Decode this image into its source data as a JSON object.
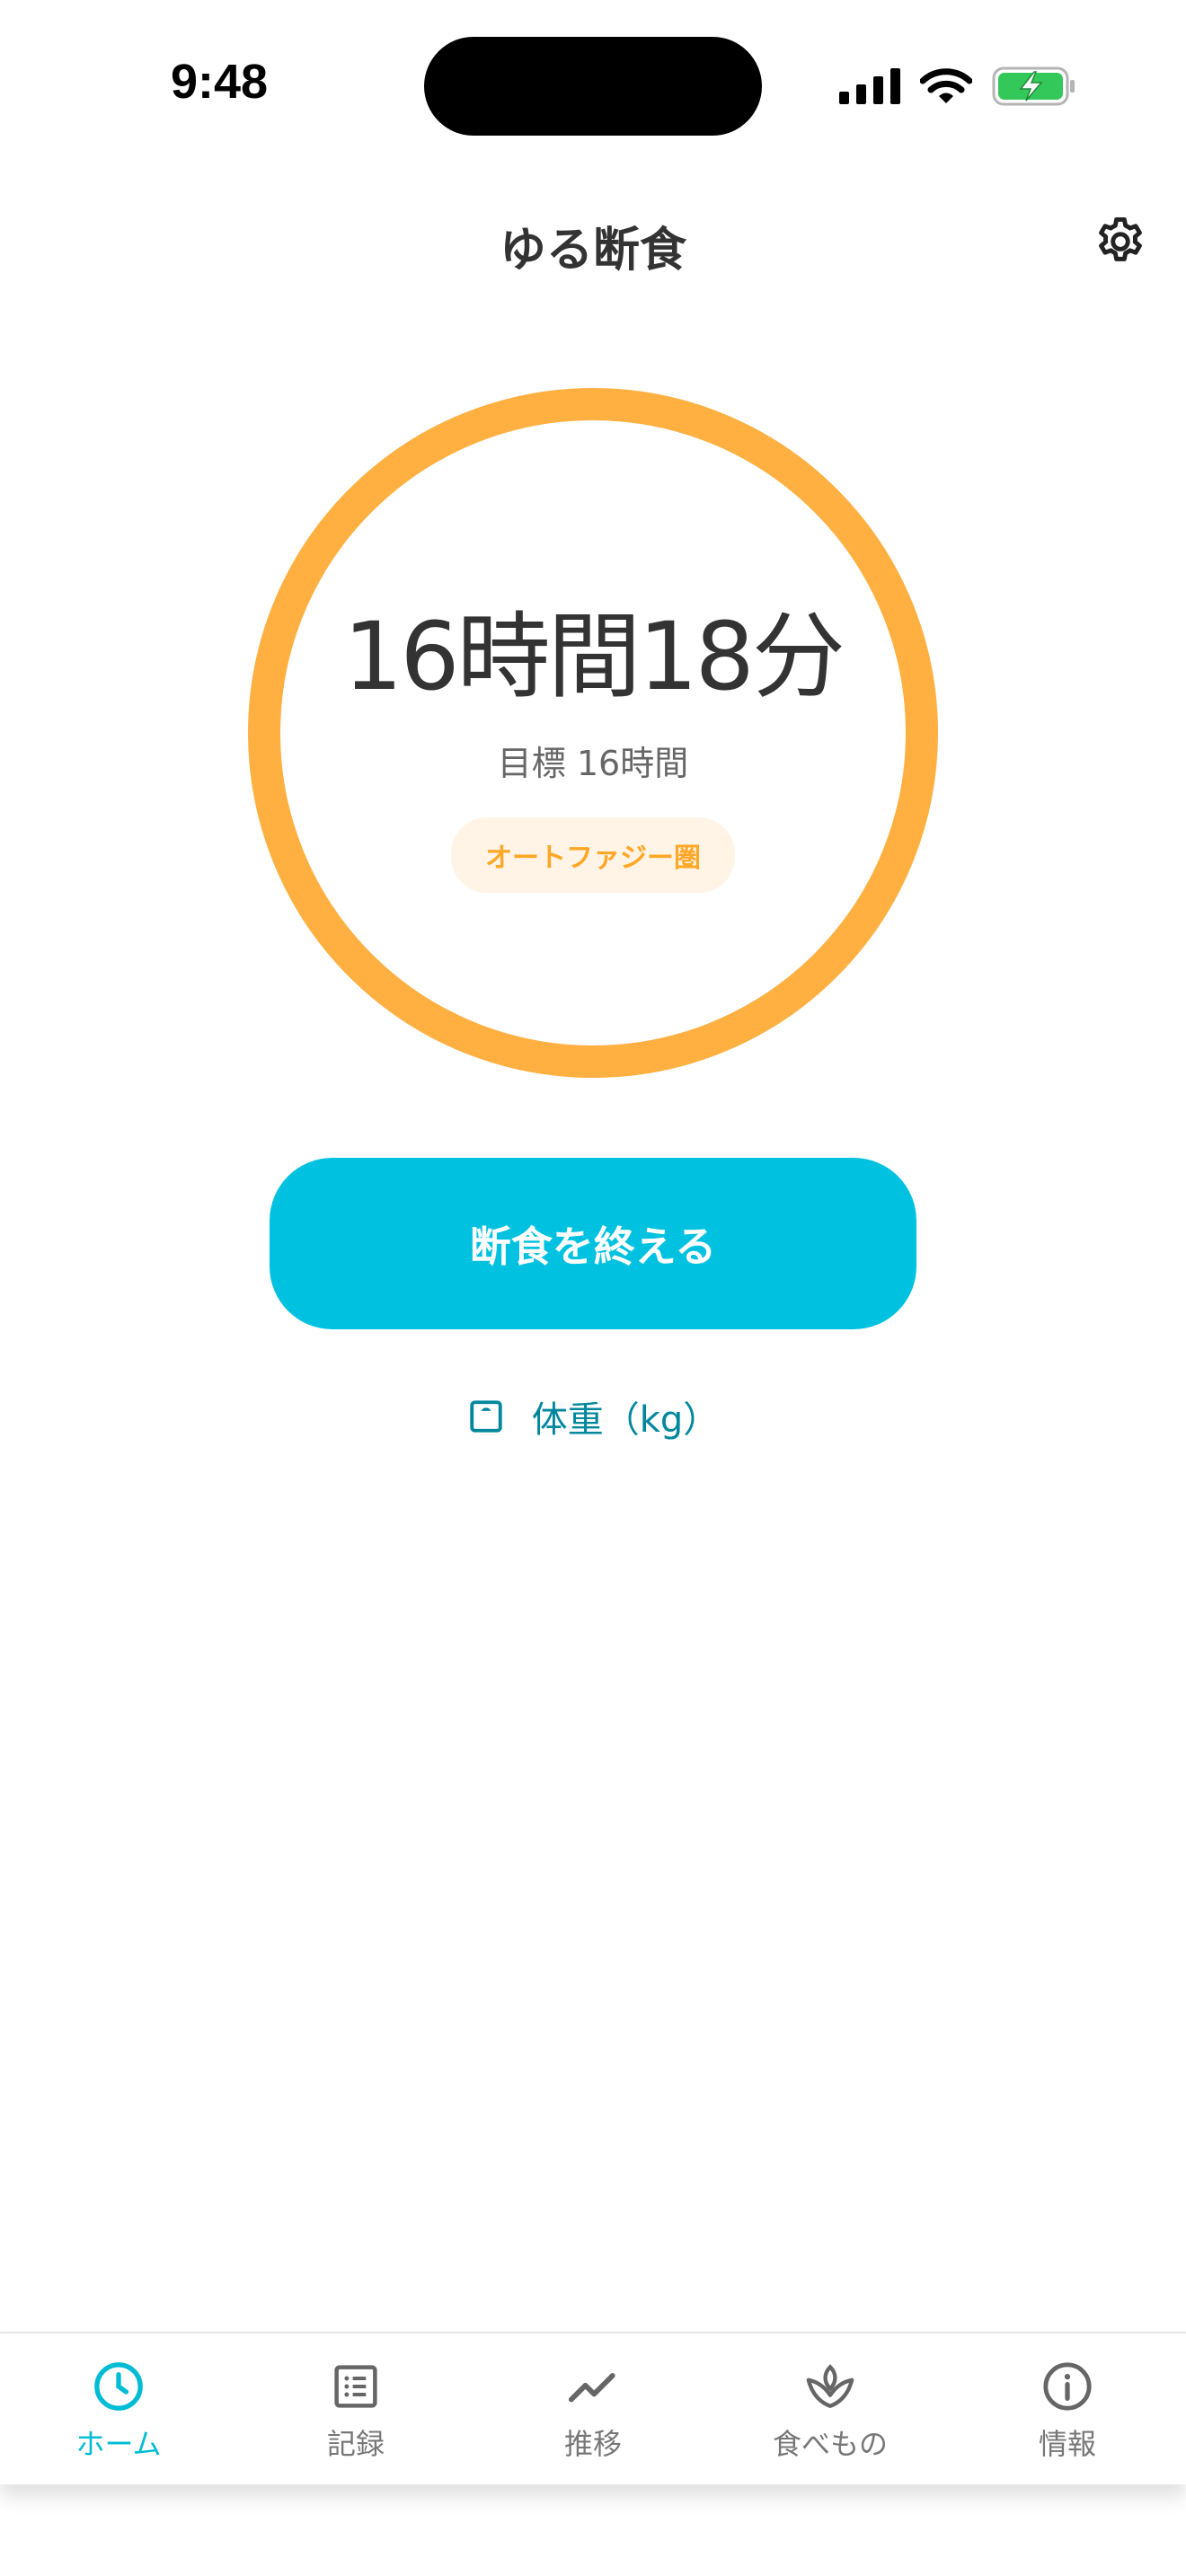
{
  "status_bar": {
    "time": "9:48"
  },
  "header": {
    "title": "ゆる断食",
    "settings_icon": "gear-icon"
  },
  "timer": {
    "elapsed": "16時間18分",
    "goal": "目標 16時間",
    "phase": "オートファジー圏",
    "progress": 1.0,
    "ring_color": "#FFB041",
    "phase_color": "#FFA726",
    "phase_bg": "#FFF4E6"
  },
  "actions": {
    "end_fast_label": "断食を終える",
    "end_fast_color": "#00C2E0",
    "weight_label": "体重（kg）",
    "weight_icon": "scale-icon"
  },
  "tabbar": {
    "active_color": "#00BCD4",
    "items": [
      {
        "label": "ホーム",
        "icon": "clock-icon",
        "active": true
      },
      {
        "label": "記録",
        "icon": "list-icon",
        "active": false
      },
      {
        "label": "推移",
        "icon": "trend-icon",
        "active": false
      },
      {
        "label": "食べもの",
        "icon": "sprout-icon",
        "active": false
      },
      {
        "label": "情報",
        "icon": "info-icon",
        "active": false
      }
    ]
  }
}
